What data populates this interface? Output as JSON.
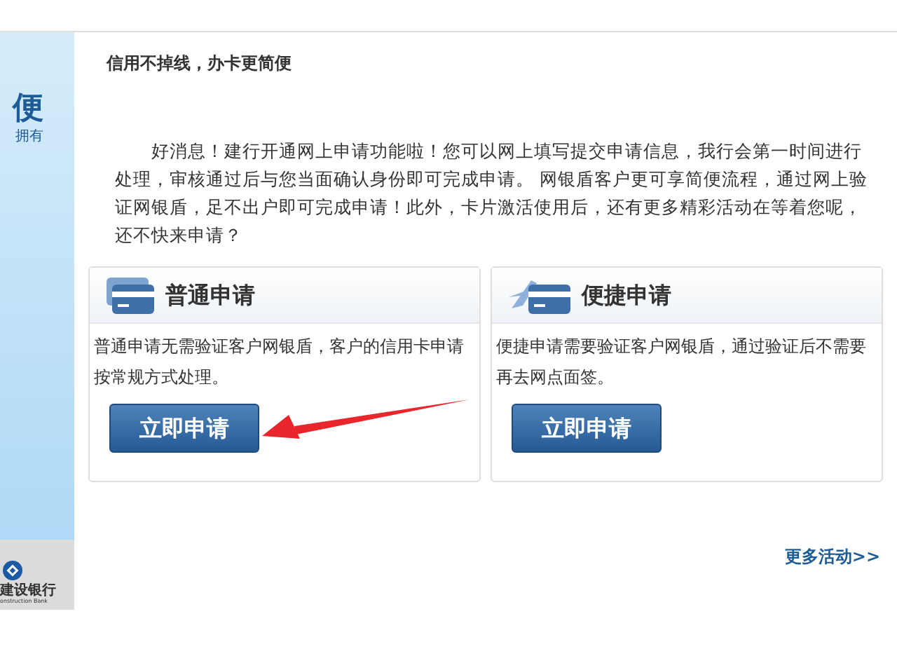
{
  "banner": {
    "headline": "便",
    "subline": "拥有",
    "logo_name": "建设银行",
    "logo_sub": "onstruction Bank"
  },
  "title": "信用不掉线，办卡更简便",
  "intro": "好消息！建行开通网上申请功能啦！您可以网上填写提交申请信息，我行会第一时间进行处理，审核通过后与您当面确认身份即可完成申请。 网银盾客户更可享简便流程，通过网上验证网银盾，足不出户即可完成申请！此外，卡片激活使用后，还有更多精彩活动在等着您呢，还不快来申请？",
  "options": [
    {
      "kind": "standard",
      "title": "普通申请",
      "description": "普通申请无需验证客户网银盾，客户的信用卡申请按常规方式处理。",
      "button": "立即申请"
    },
    {
      "kind": "quick",
      "title": "便捷申请",
      "description": "便捷申请需要验证客户网银盾，通过验证后不需要再去网点面签。",
      "button": "立即申请"
    }
  ],
  "more_link": "更多活动>>"
}
